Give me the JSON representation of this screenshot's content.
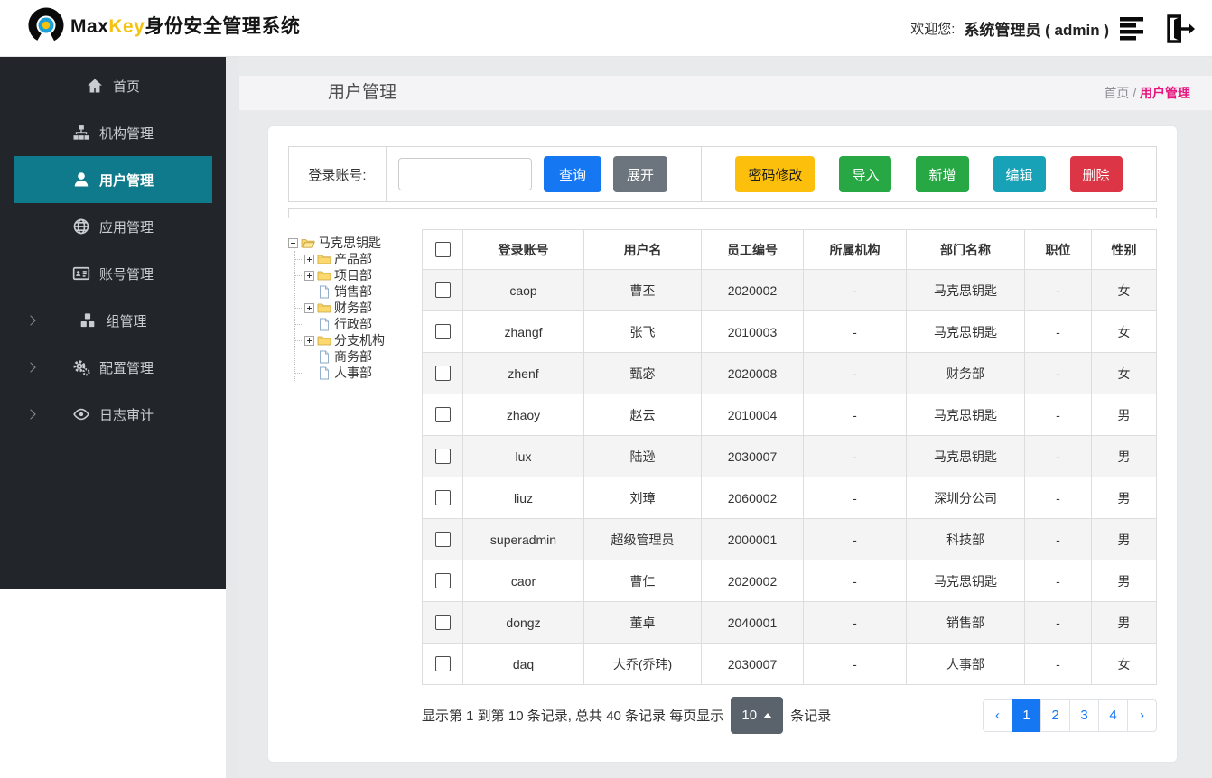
{
  "header": {
    "brand": {
      "part1": "Max",
      "part2": "Key",
      "part3": "身份安全管理系统"
    },
    "welcome_label": "欢迎您:",
    "user_label": "系统管理员 ( admin )"
  },
  "sidebar": {
    "items": [
      {
        "label": "首页",
        "icon": "home-icon",
        "name": "home",
        "active": false,
        "arrow": false
      },
      {
        "label": "机构管理",
        "icon": "sitemap-icon",
        "name": "org",
        "active": false,
        "arrow": false
      },
      {
        "label": "用户管理",
        "icon": "user-icon",
        "name": "user",
        "active": true,
        "arrow": false
      },
      {
        "label": "应用管理",
        "icon": "globe-icon",
        "name": "app",
        "active": false,
        "arrow": false
      },
      {
        "label": "账号管理",
        "icon": "idcard-icon",
        "name": "account",
        "active": false,
        "arrow": false
      },
      {
        "label": "组管理",
        "icon": "cubes-icon",
        "name": "group",
        "active": false,
        "arrow": true
      },
      {
        "label": "配置管理",
        "icon": "gears-icon",
        "name": "config",
        "active": false,
        "arrow": true
      },
      {
        "label": "日志审计",
        "icon": "eye-icon",
        "name": "audit",
        "active": false,
        "arrow": true
      }
    ],
    "active_color": "#0e7a8b"
  },
  "page": {
    "title": "用户管理",
    "breadcrumb": {
      "home": "首页",
      "separator": " / ",
      "current": "用户管理",
      "current_color": "#e7157e"
    }
  },
  "toolbar": {
    "search_label": "登录账号:",
    "search_value": "",
    "query_button": "查询",
    "expand_button": "展开",
    "actions": [
      {
        "label": "密码修改",
        "bg": "#fcc00c",
        "fg": "#1f1f1f",
        "name": "password-modify"
      },
      {
        "label": "导入",
        "bg": "#28a745",
        "fg": "#ffffff",
        "name": "import"
      },
      {
        "label": "新增",
        "bg": "#28a745",
        "fg": "#ffffff",
        "name": "add"
      },
      {
        "label": "编辑",
        "bg": "#17a2b8",
        "fg": "#ffffff",
        "name": "edit"
      },
      {
        "label": "删除",
        "bg": "#dc3545",
        "fg": "#ffffff",
        "name": "delete"
      }
    ]
  },
  "tree": {
    "root": {
      "label": "马克思钥匙",
      "type": "folder-open"
    },
    "children": [
      {
        "label": "产品部",
        "type": "folder"
      },
      {
        "label": "项目部",
        "type": "folder"
      },
      {
        "label": "销售部",
        "type": "file"
      },
      {
        "label": "财务部",
        "type": "folder"
      },
      {
        "label": "行政部",
        "type": "file"
      },
      {
        "label": "分支机构",
        "type": "folder"
      },
      {
        "label": "商务部",
        "type": "file"
      },
      {
        "label": "人事部",
        "type": "file"
      }
    ]
  },
  "table": {
    "columns": [
      "登录账号",
      "用户名",
      "员工编号",
      "所属机构",
      "部门名称",
      "职位",
      "性别"
    ],
    "rows": [
      [
        "caop",
        "曹丕",
        "2020002",
        "-",
        "马克思钥匙",
        "-",
        "女"
      ],
      [
        "zhangf",
        "张飞",
        "2010003",
        "-",
        "马克思钥匙",
        "-",
        "女"
      ],
      [
        "zhenf",
        "甄宓",
        "2020008",
        "-",
        "财务部",
        "-",
        "女"
      ],
      [
        "zhaoy",
        "赵云",
        "2010004",
        "-",
        "马克思钥匙",
        "-",
        "男"
      ],
      [
        "lux",
        "陆逊",
        "2030007",
        "-",
        "马克思钥匙",
        "-",
        "男"
      ],
      [
        "liuz",
        "刘璋",
        "2060002",
        "-",
        "深圳分公司",
        "-",
        "男"
      ],
      [
        "superadmin",
        "超级管理员",
        "2000001",
        "-",
        "科技部",
        "-",
        "男"
      ],
      [
        "caor",
        "曹仁",
        "2020002",
        "-",
        "马克思钥匙",
        "-",
        "男"
      ],
      [
        "dongz",
        "董卓",
        "2040001",
        "-",
        "销售部",
        "-",
        "男"
      ],
      [
        "daq",
        "大乔(乔玮)",
        "2030007",
        "-",
        "人事部",
        "-",
        "女"
      ]
    ]
  },
  "pagination": {
    "info_prefix": "显示第 1 到第 10 条记录, 总共 40 条记录 每页显示",
    "page_size": "10",
    "info_suffix": "条记录",
    "prev": "‹",
    "next": "›",
    "pages": [
      "1",
      "2",
      "3",
      "4"
    ],
    "active_page": "1",
    "active_color": "#1677f2"
  }
}
